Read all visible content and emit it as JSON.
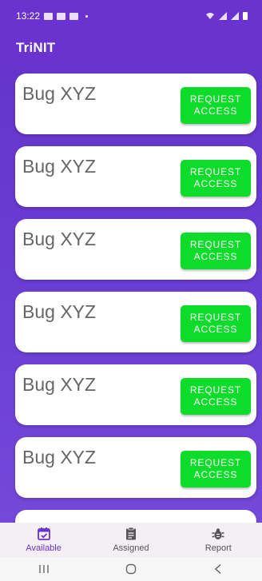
{
  "status_bar": {
    "time": "13:22"
  },
  "app_bar": {
    "title": "TriNIT"
  },
  "cards": [
    {
      "title": "Bug XYZ",
      "button_label": "REQUEST\nACCESS"
    },
    {
      "title": "Bug XYZ",
      "button_label": "REQUEST\nACCESS"
    },
    {
      "title": "Bug XYZ",
      "button_label": "REQUEST\nACCESS"
    },
    {
      "title": "Bug XYZ",
      "button_label": "REQUEST\nACCESS"
    },
    {
      "title": "Bug XYZ",
      "button_label": "REQUEST\nACCESS"
    },
    {
      "title": "Bug XYZ",
      "button_label": "REQUEST\nACCESS"
    },
    {
      "title": "",
      "button_label": ""
    }
  ],
  "bottom_nav": {
    "items": [
      {
        "label": "Available",
        "icon": "calendar-check-icon",
        "active": true
      },
      {
        "label": "Assigned",
        "icon": "clipboard-icon",
        "active": false
      },
      {
        "label": "Report",
        "icon": "bug-icon",
        "active": false
      }
    ]
  },
  "colors": {
    "primary": "#6a32cf",
    "button_green": "#0ddc2a",
    "card_text": "#666666"
  }
}
